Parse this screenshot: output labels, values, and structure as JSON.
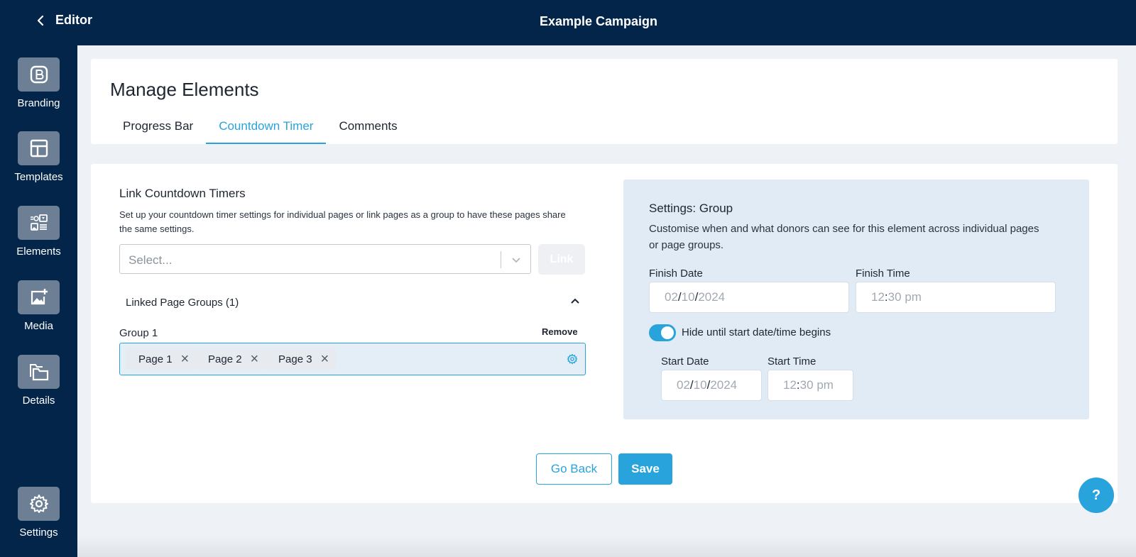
{
  "topbar": {
    "back_label": "Editor",
    "campaign_title": "Example Campaign"
  },
  "sidebar": {
    "items": [
      {
        "label": "Branding",
        "icon": "branding-icon"
      },
      {
        "label": "Templates",
        "icon": "templates-icon"
      },
      {
        "label": "Elements",
        "icon": "elements-icon"
      },
      {
        "label": "Media",
        "icon": "media-icon"
      },
      {
        "label": "Details",
        "icon": "details-icon"
      },
      {
        "label": "Settings",
        "icon": "gear-icon"
      }
    ]
  },
  "header": {
    "title": "Manage Elements",
    "tabs": [
      {
        "label": "Progress Bar",
        "active": false
      },
      {
        "label": "Countdown Timer",
        "active": true
      },
      {
        "label": "Comments",
        "active": false
      }
    ]
  },
  "link_section": {
    "title": "Link Countdown Timers",
    "description": "Set up your countdown timer settings for individual pages or link pages as a group to have these pages share the same settings.",
    "select_placeholder": "Select...",
    "link_button": "Link",
    "linked_groups_label": "Linked Page Groups (1)",
    "group": {
      "label": "Group 1",
      "remove_label": "Remove",
      "pages": [
        "Page 1",
        "Page 2",
        "Page 3"
      ]
    }
  },
  "settings": {
    "title": "Settings: Group",
    "description": "Customise when and what donors can see for this element across individual pages or page groups.",
    "finish_date_label": "Finish Date",
    "finish_date": {
      "month": "02",
      "day": "10",
      "year": "2024"
    },
    "finish_time_label": "Finish Time",
    "finish_time": {
      "hour": "12",
      "minute": "30",
      "period": "pm"
    },
    "hide_toggle": {
      "label": "Hide until start date/time begins",
      "on": true
    },
    "start_date_label": "Start Date",
    "start_date": {
      "month": "02",
      "day": "10",
      "year": "2024"
    },
    "start_time_label": "Start Time",
    "start_time": {
      "hour": "12",
      "minute": "30",
      "period": "pm"
    }
  },
  "actions": {
    "go_back": "Go Back",
    "save": "Save"
  },
  "help_label": "?",
  "colors": {
    "navy": "#03254a",
    "accent": "#29a3dc",
    "panel": "#e0ebf6"
  }
}
